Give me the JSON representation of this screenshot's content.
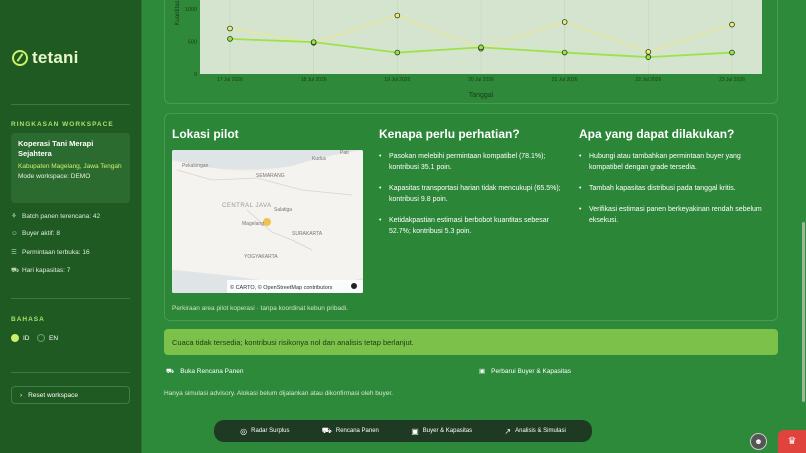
{
  "app": {
    "name": "tetani"
  },
  "sidebar": {
    "workspace_heading": "RINGKASAN WORKSPACE",
    "workspace": {
      "name": "Koperasi Tani Merapi Sejahtera",
      "location": "Kabupaten Magelang, Jawa Tengah",
      "mode": "Mode workspace: DEMO"
    },
    "stats": [
      {
        "icon": "seedling-icon",
        "label": "Batch panen terencana: 42"
      },
      {
        "icon": "user-icon",
        "label": "Buyer aktif: 8"
      },
      {
        "icon": "list-icon",
        "label": "Permintaan terbuka: 16"
      },
      {
        "icon": "truck-icon",
        "label": "Hari kapasitas: 7"
      }
    ],
    "language_heading": "BAHASA",
    "languages": [
      {
        "label": "ID",
        "selected": true
      },
      {
        "label": "EN",
        "selected": false
      }
    ],
    "reset_label": "Reset workspace"
  },
  "chart_data": {
    "type": "line",
    "x": [
      "17 Jul 2026",
      "18 Jul 2026",
      "19 Jul 2026",
      "20 Jul 2026",
      "21 Jul 2026",
      "22 Jul 2026",
      "23 Jul 2026"
    ],
    "series": [
      {
        "values": [
          700,
          480,
          900,
          390,
          800,
          340,
          760
        ],
        "color": "#f4e87a",
        "style": "dashed"
      },
      {
        "values": [
          540,
          490,
          330,
          410,
          330,
          260,
          330
        ],
        "color": "#9ee24a",
        "style": "solid"
      }
    ],
    "xlabel": "Tanggal",
    "ylabel": "Kuantitas",
    "yticks": [
      "0",
      "500",
      "1000"
    ],
    "ylim": [
      0,
      1000
    ]
  },
  "sections": {
    "pilot": {
      "title": "Lokasi pilot",
      "caption": "Perkiraan area pilot koperasi · tanpa koordinat kebun pribadi.",
      "attribution": "© CARTO, © OpenStreetMap contributors",
      "places": [
        "Pati",
        "Kudus",
        "Pekalongan",
        "SEMARANG",
        "CENTRAL JAVA",
        "Salatiga",
        "Magelang",
        "SURAKARTA",
        "YOGYAKARTA"
      ]
    },
    "why": {
      "title": "Kenapa perlu perhatian?",
      "items": [
        "Pasokan melebihi permintaan kompatibel (78.1%); kontribusi 35.1 poin.",
        "Kapasitas transportasi harian tidak mencukupi (65.5%); kontribusi 9.8 poin.",
        "Ketidakpastian estimasi berbobot kuantitas sebesar 52.7%; kontribusi 5.3 poin."
      ]
    },
    "actions": {
      "title": "Apa yang dapat dilakukan?",
      "items": [
        "Hubungi atau tambahkan permintaan buyer yang kompatibel dengan grade tersedia.",
        "Tambah kapasitas distribusi pada tanggal kritis.",
        "Verifikasi estimasi panen berkeyakinan rendah sebelum eksekusi."
      ]
    }
  },
  "notice": "Cuaca tidak tersedia; kontribusi risikonya nol dan analisis tetap berlanjut.",
  "links": {
    "harvest_plan": "Buka Rencana Panen",
    "update_buyers": "Perbarui Buyer & Kapasitas"
  },
  "advisory": "Hanya simulasi advisory. Alokasi belum dijalankan atau dikonfirmasi oleh buyer.",
  "bottom_nav": [
    {
      "icon": "radar-icon",
      "label": "Radar Surplus"
    },
    {
      "icon": "tractor-icon",
      "label": "Rencana Panen"
    },
    {
      "icon": "storefront-icon",
      "label": "Buyer & Kapasitas"
    },
    {
      "icon": "chart-icon",
      "label": "Analisis & Simulasi"
    }
  ]
}
